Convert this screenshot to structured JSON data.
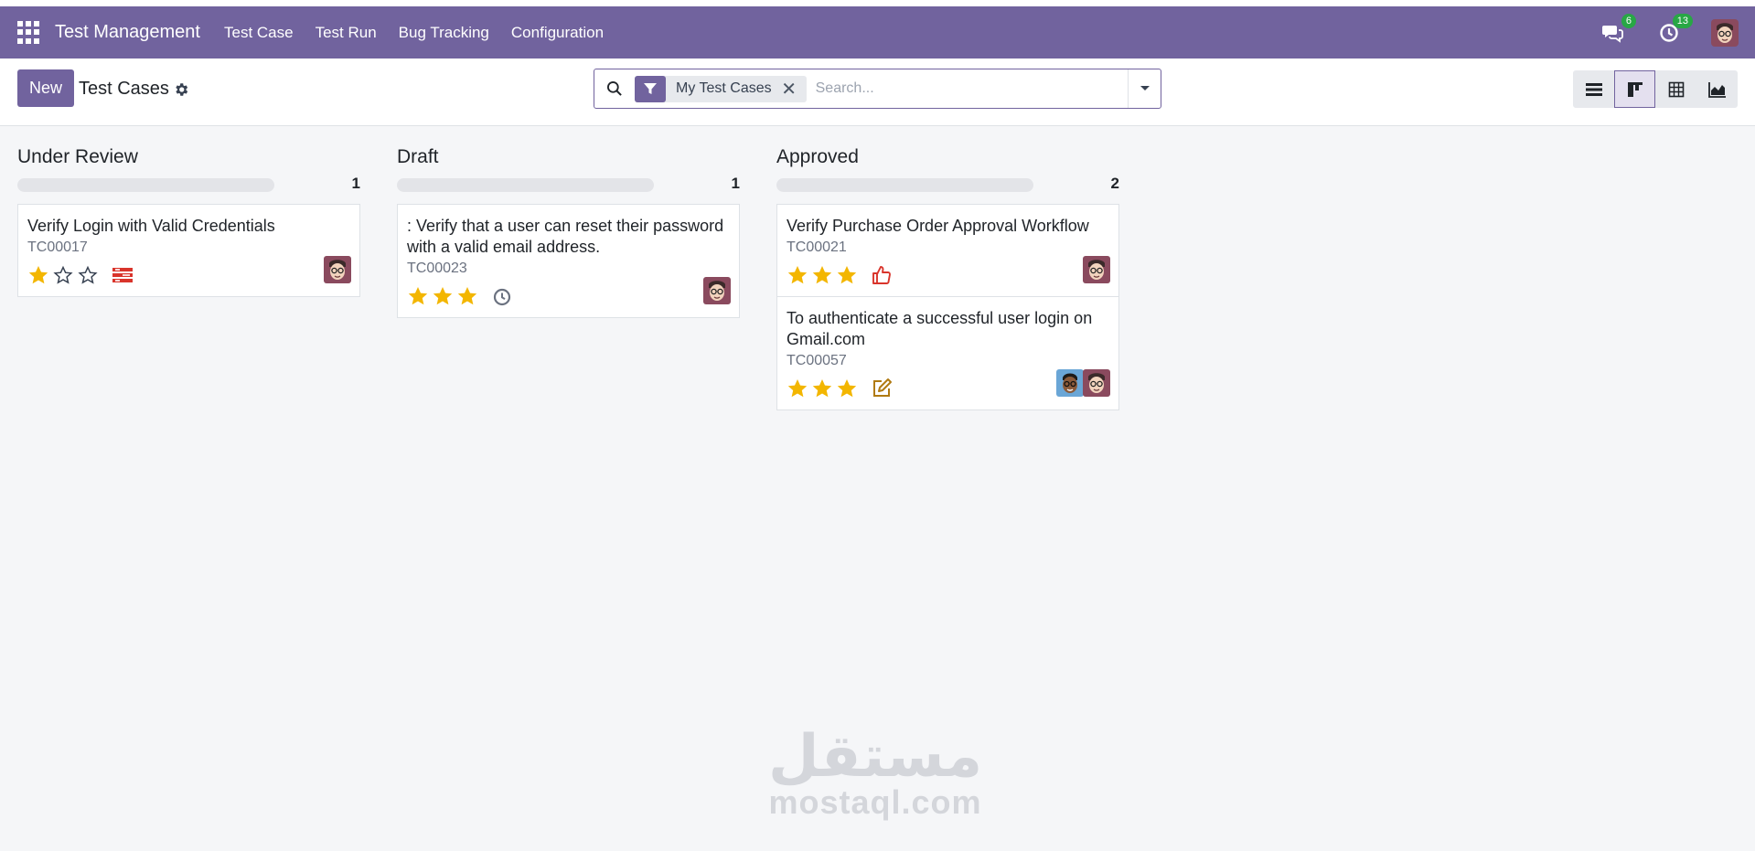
{
  "navbar": {
    "app_title": "Test Management",
    "menu": [
      "Test Case",
      "Test Run",
      "Bug Tracking",
      "Configuration"
    ],
    "messages_count": "6",
    "activities_count": "13",
    "brand_color": "#71639e"
  },
  "control_panel": {
    "new_label": "New",
    "title": "Test Cases",
    "search": {
      "facet_label": "My Test Cases",
      "placeholder": "Search..."
    },
    "views": [
      "list-icon",
      "kanban-icon",
      "pivot-icon",
      "graph-icon"
    ],
    "active_view": "kanban"
  },
  "columns": [
    {
      "title": "Under Review",
      "count": "1",
      "cards": [
        {
          "title": "Verify Login with Valid Credentials",
          "ref": "TC00017",
          "rating": 1,
          "status_icon": "blocked-bars-icon"
        }
      ]
    },
    {
      "title": "Draft",
      "count": "1",
      "cards": [
        {
          "title": ": Verify that a user can reset their password with a valid email address.",
          "ref": "TC00023",
          "rating": 3,
          "status_icon": "clock-icon"
        }
      ]
    },
    {
      "title": "Approved",
      "count": "2",
      "cards": [
        {
          "title": "Verify Purchase Order Approval Workflow",
          "ref": "TC00021",
          "rating": 3,
          "status_icon": "thumbs-up-icon"
        },
        {
          "title": "To authenticate a successful user login on Gmail.com",
          "ref": "TC00057",
          "rating": 3,
          "status_icon": "edit-icon"
        }
      ]
    }
  ],
  "colors": {
    "star": "#f3b600",
    "danger": "#d9342b",
    "progress_empty": "#e3e4e8",
    "badge": "#28a745"
  },
  "watermark": {
    "arabic": "مستقل",
    "latin": "mostaql.com"
  }
}
